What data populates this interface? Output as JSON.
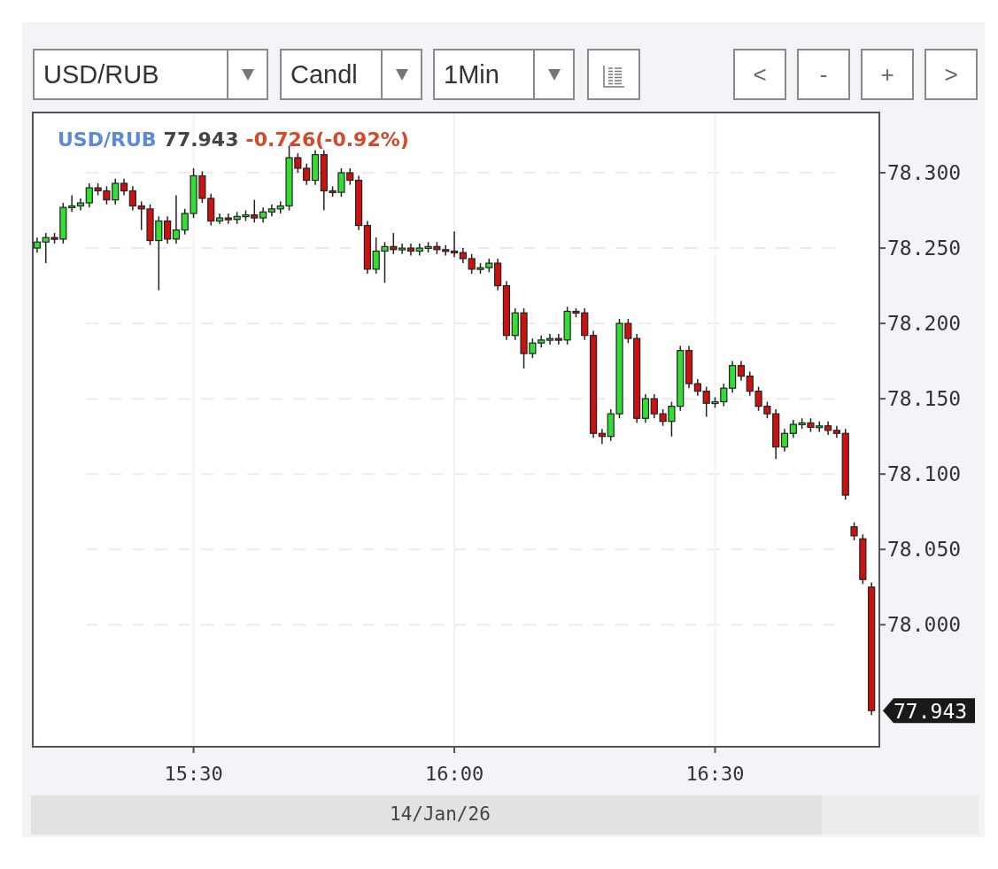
{
  "toolbar": {
    "selects": [
      {
        "value": "USD/RUB"
      },
      {
        "value": "Candl"
      },
      {
        "value": "1Min"
      }
    ],
    "nav_buttons": [
      "<",
      "-",
      "+",
      ">"
    ]
  },
  "chart": {
    "legend": {
      "symbol": "USD/RUB",
      "price": "77.943",
      "change": "-0.726(-0.92%)"
    },
    "price_tag": "77.943",
    "date_label": "14/Jan/26",
    "chart_data": {
      "type": "candlestick",
      "grid": true,
      "categories": [
        null,
        null,
        null,
        null,
        null,
        null,
        null,
        null,
        null,
        null,
        null,
        null,
        null,
        null,
        null,
        null,
        null,
        null,
        "15:30",
        null,
        null,
        null,
        null,
        null,
        null,
        null,
        null,
        null,
        null,
        null,
        null,
        null,
        null,
        null,
        null,
        null,
        null,
        null,
        null,
        null,
        null,
        null,
        null,
        null,
        null,
        null,
        null,
        null,
        "16:00",
        null,
        null,
        null,
        null,
        null,
        null,
        null,
        null,
        null,
        null,
        null,
        null,
        null,
        null,
        null,
        null,
        null,
        null,
        null,
        null,
        null,
        null,
        null,
        null,
        null,
        null,
        null,
        null,
        null,
        "16:30",
        null,
        null,
        null,
        null,
        null,
        null,
        null,
        null,
        null,
        null,
        null,
        null,
        null,
        null,
        null,
        null,
        null,
        null
      ],
      "ylim": [
        77.919,
        78.34
      ],
      "yticks": [
        {
          "value": 78.3,
          "label": "78.300"
        },
        {
          "value": 78.25,
          "label": "78.250"
        },
        {
          "value": 78.2,
          "label": "78.200"
        },
        {
          "value": 78.15,
          "label": "78.150"
        },
        {
          "value": 78.1,
          "label": "78.100"
        },
        {
          "value": 78.05,
          "label": "78.050"
        },
        {
          "value": 78.0,
          "label": "78.000"
        }
      ],
      "ohlc": [
        [
          78.25,
          78.257,
          78.247,
          78.254
        ],
        [
          78.254,
          78.26,
          78.24,
          78.257
        ],
        [
          78.257,
          78.26,
          78.253,
          78.256
        ],
        [
          78.256,
          78.28,
          78.253,
          78.277
        ],
        [
          78.277,
          78.285,
          78.274,
          78.278
        ],
        [
          78.278,
          78.283,
          78.275,
          78.28
        ],
        [
          78.28,
          78.293,
          78.277,
          78.29
        ],
        [
          78.29,
          78.293,
          78.285,
          78.288
        ],
        [
          78.288,
          78.291,
          78.279,
          78.282
        ],
        [
          78.282,
          78.296,
          78.279,
          78.293
        ],
        [
          78.293,
          78.296,
          78.285,
          78.288
        ],
        [
          78.288,
          78.291,
          78.275,
          78.278
        ],
        [
          78.278,
          78.281,
          78.262,
          78.276
        ],
        [
          78.276,
          78.279,
          78.252,
          78.255
        ],
        [
          78.255,
          78.271,
          78.222,
          78.268
        ],
        [
          78.268,
          78.271,
          78.253,
          78.256
        ],
        [
          78.256,
          78.285,
          78.253,
          78.262
        ],
        [
          78.262,
          78.276,
          78.259,
          78.273
        ],
        [
          78.273,
          78.303,
          78.27,
          78.298
        ],
        [
          78.298,
          78.301,
          78.28,
          78.283
        ],
        [
          78.283,
          78.286,
          78.265,
          78.268
        ],
        [
          78.268,
          78.273,
          78.266,
          78.27
        ],
        [
          78.27,
          78.273,
          78.266,
          78.269
        ],
        [
          78.269,
          78.274,
          78.266,
          78.271
        ],
        [
          78.271,
          78.275,
          78.268,
          78.272
        ],
        [
          78.272,
          78.282,
          78.267,
          78.27
        ],
        [
          78.27,
          78.277,
          78.267,
          78.274
        ],
        [
          78.274,
          78.279,
          78.271,
          78.276
        ],
        [
          78.276,
          78.281,
          78.273,
          78.278
        ],
        [
          78.278,
          78.318,
          78.275,
          78.31
        ],
        [
          78.31,
          78.313,
          78.3,
          78.303
        ],
        [
          78.303,
          78.306,
          78.292,
          78.295
        ],
        [
          78.295,
          78.315,
          78.292,
          78.312
        ],
        [
          78.312,
          78.315,
          78.275,
          78.288
        ],
        [
          78.288,
          78.291,
          78.284,
          78.287
        ],
        [
          78.287,
          78.303,
          78.284,
          78.3
        ],
        [
          78.3,
          78.303,
          78.292,
          78.295
        ],
        [
          78.295,
          78.298,
          78.262,
          78.265
        ],
        [
          78.265,
          78.268,
          78.233,
          78.236
        ],
        [
          78.236,
          78.257,
          78.233,
          78.248
        ],
        [
          78.248,
          78.254,
          78.227,
          78.251
        ],
        [
          78.251,
          78.26,
          78.246,
          78.249
        ],
        [
          78.249,
          78.253,
          78.246,
          78.25
        ],
        [
          78.25,
          78.253,
          78.245,
          78.248
        ],
        [
          78.248,
          78.253,
          78.245,
          78.25
        ],
        [
          78.25,
          78.254,
          78.247,
          78.251
        ],
        [
          78.251,
          78.254,
          78.246,
          78.249
        ],
        [
          78.249,
          78.252,
          78.245,
          78.248
        ],
        [
          78.248,
          78.261,
          78.244,
          78.247
        ],
        [
          78.247,
          78.25,
          78.24,
          78.243
        ],
        [
          78.243,
          78.246,
          78.233,
          78.236
        ],
        [
          78.236,
          78.24,
          78.233,
          78.237
        ],
        [
          78.237,
          78.243,
          78.234,
          78.24
        ],
        [
          78.24,
          78.243,
          78.222,
          78.225
        ],
        [
          78.225,
          78.228,
          78.189,
          78.192
        ],
        [
          78.192,
          78.21,
          78.189,
          78.207
        ],
        [
          78.207,
          78.21,
          78.17,
          78.18
        ],
        [
          78.18,
          78.19,
          78.177,
          78.187
        ],
        [
          78.187,
          78.192,
          78.184,
          78.189
        ],
        [
          78.189,
          78.193,
          78.186,
          78.19
        ],
        [
          78.19,
          78.193,
          78.186,
          78.189
        ],
        [
          78.189,
          78.211,
          78.186,
          78.208
        ],
        [
          78.208,
          78.21,
          78.204,
          78.207
        ],
        [
          78.207,
          78.21,
          78.189,
          78.192
        ],
        [
          78.192,
          78.195,
          78.124,
          78.127
        ],
        [
          78.127,
          78.13,
          78.12,
          78.125
        ],
        [
          78.125,
          78.143,
          78.122,
          78.14
        ],
        [
          78.14,
          78.203,
          78.137,
          78.2
        ],
        [
          78.2,
          78.203,
          78.187,
          78.19
        ],
        [
          78.19,
          78.193,
          78.134,
          78.137
        ],
        [
          78.137,
          78.153,
          78.134,
          78.15
        ],
        [
          78.15,
          78.153,
          78.137,
          78.14
        ],
        [
          78.14,
          78.143,
          78.132,
          78.135
        ],
        [
          78.135,
          78.148,
          78.125,
          78.145
        ],
        [
          78.145,
          78.185,
          78.142,
          78.182
        ],
        [
          78.182,
          78.185,
          78.157,
          78.16
        ],
        [
          78.16,
          78.163,
          78.152,
          78.155
        ],
        [
          78.155,
          78.158,
          78.138,
          78.147
        ],
        [
          78.147,
          78.151,
          78.144,
          78.148
        ],
        [
          78.148,
          78.16,
          78.145,
          78.157
        ],
        [
          78.157,
          78.175,
          78.154,
          78.172
        ],
        [
          78.172,
          78.175,
          78.162,
          78.165
        ],
        [
          78.165,
          78.168,
          78.152,
          78.155
        ],
        [
          78.155,
          78.158,
          78.142,
          78.145
        ],
        [
          78.145,
          78.148,
          78.137,
          78.14
        ],
        [
          78.14,
          78.143,
          78.11,
          78.118
        ],
        [
          78.118,
          78.13,
          78.115,
          78.127
        ],
        [
          78.127,
          78.136,
          78.124,
          78.133
        ],
        [
          78.133,
          78.137,
          78.13,
          78.134
        ],
        [
          78.134,
          78.137,
          78.128,
          78.131
        ],
        [
          78.131,
          78.135,
          78.128,
          78.132
        ],
        [
          78.132,
          78.135,
          78.126,
          78.129
        ],
        [
          78.129,
          78.132,
          78.124,
          78.127
        ],
        [
          78.127,
          78.13,
          78.083,
          78.086
        ],
        [
          78.065,
          78.068,
          78.056,
          78.059
        ],
        [
          78.057,
          78.06,
          78.027,
          78.03
        ],
        [
          78.025,
          78.028,
          77.94,
          77.943
        ]
      ]
    }
  }
}
